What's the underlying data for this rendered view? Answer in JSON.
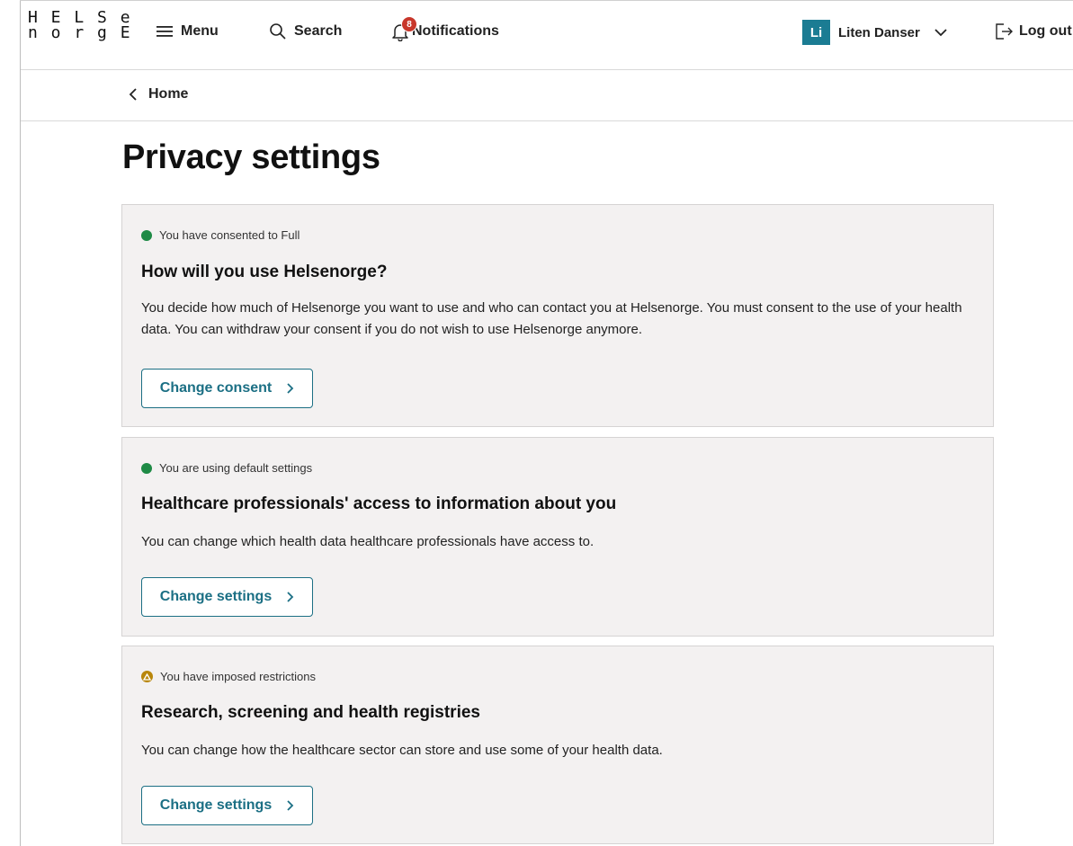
{
  "header": {
    "logo_line1": "H E L S e",
    "logo_line2": "n o r g E",
    "menu_label": "Menu",
    "search_label": "Search",
    "notifications_label": "Notifications",
    "notifications_count": "8",
    "user_initials": "Li",
    "user_name": "Liten Danser",
    "logout_label": "Log out"
  },
  "breadcrumb": {
    "label": "Home"
  },
  "page": {
    "title": "Privacy settings"
  },
  "cards": [
    {
      "status": "You have consented to Full",
      "status_kind": "ok",
      "heading": "How will you use Helsenorge?",
      "text": "You decide how much of Helsenorge you want to use and who can contact you at Helsenorge. You must consent to the use of your health data. You can withdraw your consent if you do not wish to use Helsenorge anymore.",
      "button": "Change consent"
    },
    {
      "status": "You are using default settings",
      "status_kind": "ok",
      "heading": "Healthcare professionals' access to information about you",
      "text": "You can change which health data healthcare professionals have access to.",
      "button": "Change settings"
    },
    {
      "status": "You have imposed restrictions",
      "status_kind": "warning",
      "heading": "Research, screening and health registries",
      "text": "You can change how the healthcare sector can store and use some of your health data.",
      "button": "Change settings"
    }
  ],
  "colors": {
    "accent": "#1b6f84",
    "avatar": "#1b7c93",
    "status_ok": "#1e8a45",
    "status_warning": "#b8860b",
    "badge": "#c8372b",
    "card_bg": "#f3f1f1"
  }
}
